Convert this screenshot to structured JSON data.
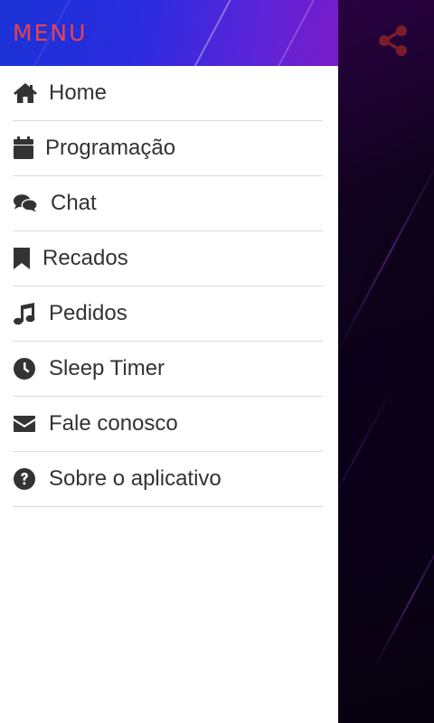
{
  "drawer": {
    "title": "MENU",
    "items": [
      {
        "label": "Home",
        "icon": "home-icon"
      },
      {
        "label": "Programação",
        "icon": "calendar-icon"
      },
      {
        "label": "Chat",
        "icon": "chat-bubbles-icon"
      },
      {
        "label": "Recados",
        "icon": "bookmark-icon"
      },
      {
        "label": "Pedidos",
        "icon": "music-note-icon"
      },
      {
        "label": "Sleep Timer",
        "icon": "clock-icon"
      },
      {
        "label": "Fale conosco",
        "icon": "envelope-icon"
      },
      {
        "label": "Sobre o aplicativo",
        "icon": "question-circle-icon"
      }
    ]
  },
  "background_app": {
    "share_icon": "share-icon"
  },
  "colors": {
    "header_gradient_start": "#1b33d6",
    "header_gradient_end": "#7a1cc8",
    "title_color": "#e8434f",
    "icon_color": "#333333",
    "share_icon_color": "#7a1d2a"
  }
}
